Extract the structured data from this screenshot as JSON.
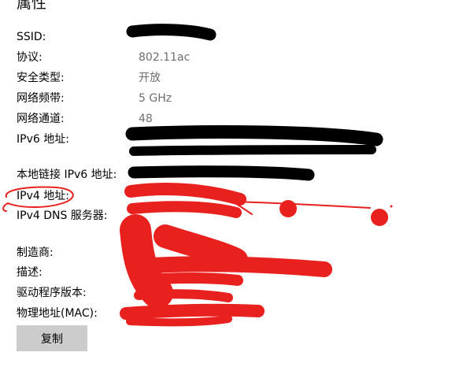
{
  "page_title": "属性",
  "properties": [
    {
      "label": "SSID:",
      "value": ""
    },
    {
      "label": "协议:",
      "value": "802.11ac"
    },
    {
      "label": "安全类型:",
      "value": "开放"
    },
    {
      "label": "网络频带:",
      "value": "5 GHz"
    },
    {
      "label": "网络通道:",
      "value": "48"
    },
    {
      "label": "IPv6 地址:",
      "value": ""
    },
    {
      "label": "本地链接 IPv6 地址:",
      "value": ""
    },
    {
      "label": "IPv4 地址:",
      "value": ""
    },
    {
      "label": "IPv4 DNS 服务器:",
      "value": ""
    },
    {
      "label": "制造商:",
      "value": ""
    },
    {
      "label": "描述:",
      "value": ""
    },
    {
      "label": "驱动程序版本:",
      "value": ""
    },
    {
      "label": "物理地址(MAC):",
      "value": ""
    }
  ],
  "copy_button_label": "复制",
  "redaction_colors": {
    "black": "#000000",
    "red": "#e8201e"
  }
}
